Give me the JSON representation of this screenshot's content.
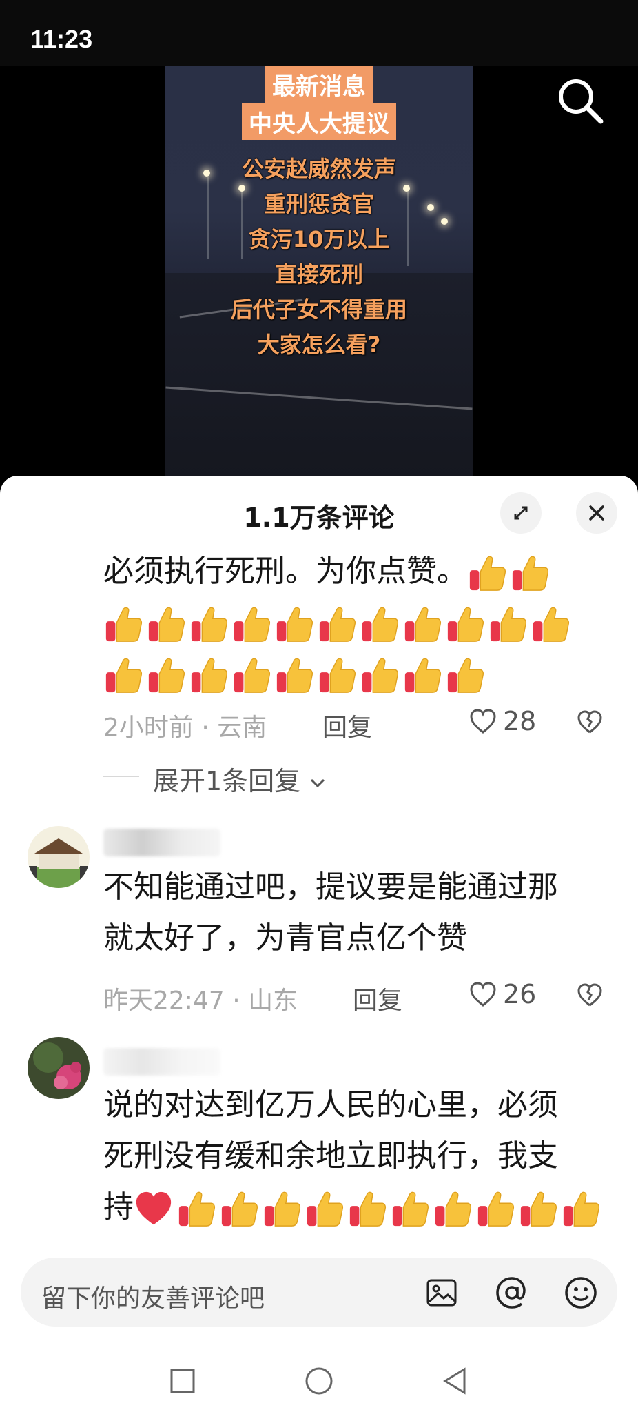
{
  "status_bar": {
    "time": "11:23"
  },
  "video": {
    "tag1": "最新消息",
    "tag2": "中央人大提议",
    "lines": [
      "公安赵威然发声",
      "重刑惩贪官",
      "贪污10万以上",
      "直接死刑",
      "后代子女不得重用",
      "大家怎么看?"
    ]
  },
  "comments_header": {
    "title": "1.1万条评论"
  },
  "comments": [
    {
      "text_lines": [
        "必须执行死刑。为你点赞。"
      ],
      "emoji_rows": [
        2,
        11,
        9
      ],
      "meta": "2小时前 · 云南",
      "reply_label": "回复",
      "likes": "28"
    },
    {
      "username": "",
      "text_lines": [
        "不知能通过吧，提议要是能通过那",
        "就太好了，为青官点亿个赞"
      ],
      "meta": "昨天22:47 · 山东",
      "reply_label": "回复",
      "likes": "26"
    },
    {
      "username": "",
      "text_lines": [
        "说的对达到亿万人民的心里，必须",
        "死刑没有缓和余地立即执行，我支",
        "持"
      ],
      "heart_after_last_line": true,
      "thumbs_after_heart": 10
    }
  ],
  "expand_replies": "展开1条回复",
  "input": {
    "placeholder": "留下你的友善评论吧"
  },
  "icons": {
    "search": "search-icon",
    "collapse": "collapse-icon",
    "close": "close-icon",
    "image": "image-icon",
    "at": "at-icon",
    "emoji": "emoji-icon",
    "heart": "heart-icon",
    "dislike": "broken-heart-icon",
    "thumbs_up": "thumbs-up-emoji"
  },
  "colors": {
    "overlay_tag_bg": "#f29b66",
    "overlay_text": "#f6a15e",
    "heart_red": "#e8374a",
    "thumb_yellow": "#f7c23b"
  }
}
